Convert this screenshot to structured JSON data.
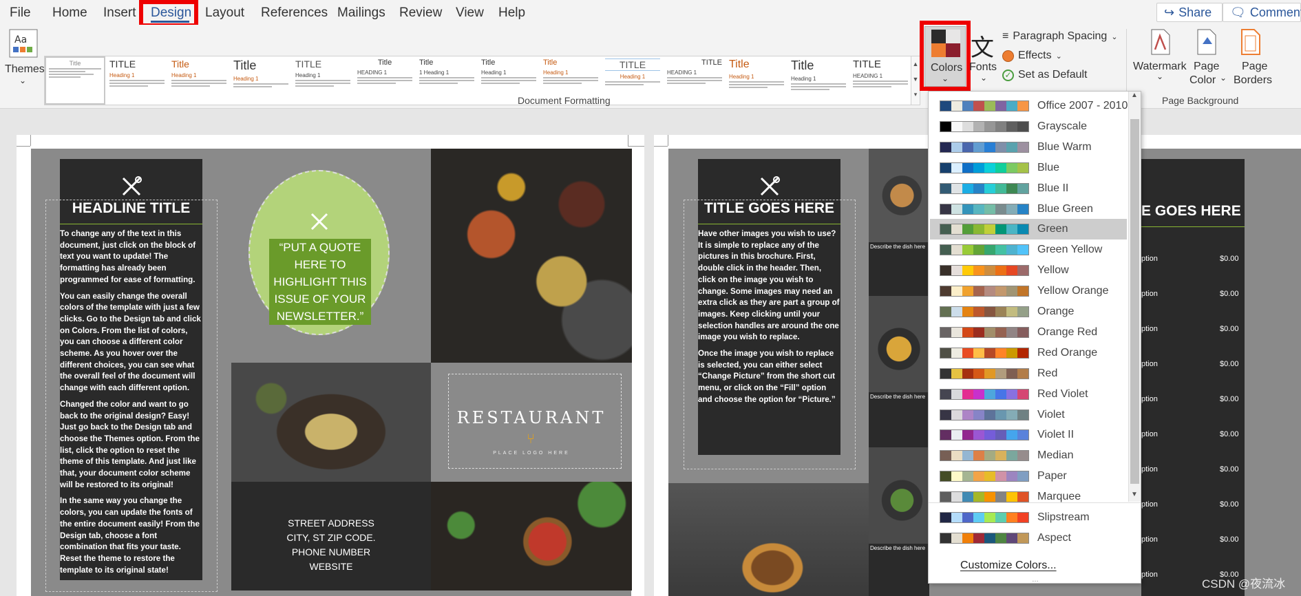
{
  "menu": {
    "tabs": [
      "File",
      "Home",
      "Insert",
      "Design",
      "Layout",
      "References",
      "Mailings",
      "Review",
      "View",
      "Help"
    ],
    "share": "Share",
    "comments": "Comments"
  },
  "ribbon": {
    "themes_label": "Themes",
    "style_titles": [
      "Title",
      "TITLE",
      "Title",
      "Title",
      "TITLE",
      "Title",
      "Title",
      "Title",
      "Title",
      "TITLE",
      "TITLE",
      "Title",
      "Title",
      "TITLE"
    ],
    "colors_label": "Colors",
    "fonts_label": "Fonts",
    "paragraph_spacing": "Paragraph Spacing",
    "effects": "Effects",
    "set_as_default": "Set as Default",
    "document_formatting": "Document Formatting",
    "watermark": "Watermark",
    "page_color": "Page Color",
    "page_color_l1": "Page",
    "page_color_l2": "Color",
    "page_borders_l1": "Page",
    "page_borders_l2": "Borders",
    "page_background": "Page Background"
  },
  "doc_left": {
    "headline": "HEADLINE TITLE",
    "body": [
      "To change any of the text in this document, just click on the block of text you want to update!  The formatting has already been programmed for ease of formatting.",
      "You can easily change the overall colors of the template with just a few clicks.  Go to the Design tab and click on Colors.  From the list of colors, you can choose a different color scheme.  As you hover over the different choices, you can see what the overall feel of the document will change with each different option.",
      "Changed the color and want to go back to the original design?  Easy!  Just go back to the Design tab and choose the Themes option.  From the list, click the option to reset the theme of this template.  And just like that, your document color scheme will be restored to its original!",
      "In the same way you change the colors, you can update the fonts of the entire document easily!  From the Design tab, choose a font combination that fits your taste.  Reset the theme to restore the template to its original state!"
    ],
    "quote": "“PUT A QUOTE HERE TO HIGHLIGHT THIS ISSUE OF YOUR NEWSLETTER.”",
    "logo_text": "RESTAURANT",
    "logo_sub": "PLACE LOGO HERE",
    "address": [
      "STREET ADDRESS",
      "CITY, ST ZIP CODE.",
      "PHONE NUMBER",
      "WEBSITE"
    ]
  },
  "doc_right": {
    "title": "TITLE GOES HERE",
    "title2": "E GOES HERE",
    "body": [
      "Have other images you wish to use?  It is simple to replace any of the pictures in this brochure.  First, double click in the header.  Then, click on the image you wish to change.  Some images may need an extra click as they are part a group of images.  Keep clicking until your selection handles are around the one image you wish to replace.",
      "Once the image you wish to replace is selected, you can either select “Change Picture” from the short cut menu, or click on the “Fill” option and choose the option for “Picture.”"
    ],
    "caption": "Describe the dish here",
    "menu_items": [
      "ption",
      "ption",
      "ption",
      "ption",
      "ption",
      "ption",
      "ption",
      "ption",
      "ption",
      "ption"
    ],
    "price": "$0.00"
  },
  "color_menu": {
    "selected": "Green",
    "customize": "Customize Colors...",
    "schemes": [
      {
        "name": "Office 2007 - 2010",
        "colors": [
          "#1f497d",
          "#eeece1",
          "#4f81bd",
          "#c0504d",
          "#9bbb59",
          "#8064a2",
          "#4bacc6",
          "#f79646"
        ]
      },
      {
        "name": "Grayscale",
        "colors": [
          "#000000",
          "#f8f8f8",
          "#dddddd",
          "#b2b2b2",
          "#969696",
          "#808080",
          "#5f5f5f",
          "#4d4d4d"
        ]
      },
      {
        "name": "Blue Warm",
        "colors": [
          "#242852",
          "#acccea",
          "#4a66ac",
          "#629dd1",
          "#297fd5",
          "#7f8fa9",
          "#5aa2ae",
          "#9d90a0"
        ]
      },
      {
        "name": "Blue",
        "colors": [
          "#17406d",
          "#dbefff",
          "#0f6fc6",
          "#009dd9",
          "#0bd0d9",
          "#10cf9b",
          "#7cca62",
          "#a5c249"
        ]
      },
      {
        "name": "Blue II",
        "colors": [
          "#335b74",
          "#dfe3e5",
          "#1cade4",
          "#2683c6",
          "#27ced7",
          "#42ba97",
          "#3e8853",
          "#62a39f"
        ]
      },
      {
        "name": "Blue Green",
        "colors": [
          "#373545",
          "#cee2e2",
          "#3494ba",
          "#58b6c0",
          "#75bda7",
          "#7a8c8e",
          "#84acb6",
          "#2683c6"
        ]
      },
      {
        "name": "Green",
        "colors": [
          "#455f51",
          "#e3ded1",
          "#549e39",
          "#8ab833",
          "#c0cf3a",
          "#029676",
          "#4ab5c4",
          "#0989b1"
        ]
      },
      {
        "name": "Green Yellow",
        "colors": [
          "#455f51",
          "#e3ded1",
          "#99cb38",
          "#63a537",
          "#37a76f",
          "#44c1a3",
          "#4eb3cf",
          "#51c3f9"
        ]
      },
      {
        "name": "Yellow",
        "colors": [
          "#39302a",
          "#e5dedb",
          "#ffca08",
          "#f8931d",
          "#ce8d3e",
          "#ec7016",
          "#e64823",
          "#9c6a6a"
        ]
      },
      {
        "name": "Yellow Orange",
        "colors": [
          "#4e3b30",
          "#fbeec9",
          "#f0a22e",
          "#a5644e",
          "#b58b80",
          "#c3986d",
          "#a19574",
          "#c17529"
        ]
      },
      {
        "name": "Orange",
        "colors": [
          "#637052",
          "#ccddea",
          "#e48312",
          "#bd582c",
          "#865640",
          "#9b8357",
          "#c2bc80",
          "#94a088"
        ]
      },
      {
        "name": "Orange Red",
        "colors": [
          "#696464",
          "#e9e5dc",
          "#d34817",
          "#9b2d1f",
          "#a28e6a",
          "#956251",
          "#918485",
          "#855d5d"
        ]
      },
      {
        "name": "Red Orange",
        "colors": [
          "#505046",
          "#eeece1",
          "#e84c22",
          "#ffbd47",
          "#b64926",
          "#ff8427",
          "#cc9900",
          "#b22600"
        ]
      },
      {
        "name": "Red",
        "colors": [
          "#323232",
          "#e5c243",
          "#a5300f",
          "#d55816",
          "#e19825",
          "#b19c7d",
          "#7f5f52",
          "#b27d49"
        ]
      },
      {
        "name": "Red Violet",
        "colors": [
          "#454551",
          "#d8d9dc",
          "#e32d91",
          "#c830cc",
          "#4ea6dc",
          "#4775e7",
          "#8971e1",
          "#d54773"
        ]
      },
      {
        "name": "Violet",
        "colors": [
          "#373545",
          "#dcd8dc",
          "#ad84c6",
          "#8784c7",
          "#5d739a",
          "#6997af",
          "#84acb6",
          "#6f8183"
        ]
      },
      {
        "name": "Violet II",
        "colors": [
          "#632e62",
          "#eaeef2",
          "#92278f",
          "#9b57d3",
          "#755dd9",
          "#665eb8",
          "#45a5ed",
          "#5982db"
        ]
      },
      {
        "name": "Median",
        "colors": [
          "#775f55",
          "#ebddc3",
          "#94b6d2",
          "#dd8047",
          "#a5ab81",
          "#d8b25c",
          "#7ba79d",
          "#968c8c"
        ]
      },
      {
        "name": "Paper",
        "colors": [
          "#444d26",
          "#fefac9",
          "#a5b592",
          "#f3a447",
          "#e7bc29",
          "#d092a7",
          "#9c85c0",
          "#809ec2"
        ]
      },
      {
        "name": "Marquee",
        "colors": [
          "#5e5e5e",
          "#ddddde",
          "#418ab3",
          "#a6b727",
          "#f69200",
          "#838383",
          "#fec306",
          "#df5327"
        ]
      },
      {
        "name": "Slipstream",
        "colors": [
          "#212745",
          "#b4dcfa",
          "#4e67c8",
          "#5eccf3",
          "#a7ea52",
          "#5dceaf",
          "#ff8021",
          "#f14124"
        ]
      },
      {
        "name": "Aspect",
        "colors": [
          "#323232",
          "#e3ded1",
          "#f07f09",
          "#9f2936",
          "#1b587c",
          "#4e8542",
          "#604878",
          "#c19859"
        ]
      }
    ]
  },
  "watermark_text": "CSDN @夜流冰"
}
